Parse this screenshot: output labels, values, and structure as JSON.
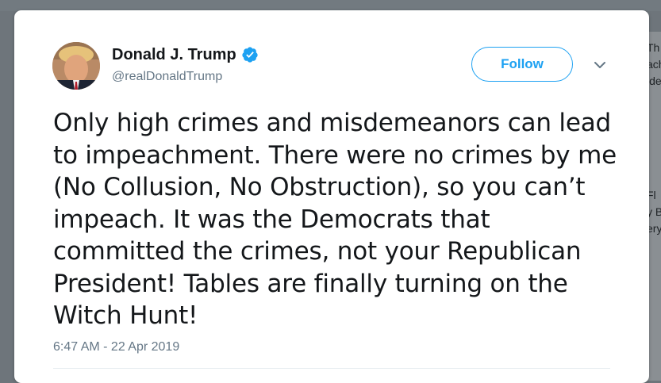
{
  "background": {
    "right_snippet_top": [
      "Th",
      "ach",
      "ide"
    ],
    "right_snippet_mid": [
      "Fl",
      "y B",
      "ery"
    ]
  },
  "tweet": {
    "author": {
      "display_name": "Donald J. Trump",
      "handle": "@realDonaldTrump",
      "verified": true
    },
    "follow_label": "Follow",
    "text_lines": [
      "Only high crimes and misdemeanors can lead",
      "to impeachment. There were no crimes by me",
      "(No Collusion, No Obstruction), so you can’t",
      "impeach. It was the Democrats that",
      "committed the crimes, not your Republican",
      "President! Tables are finally turning on the",
      "Witch Hunt!"
    ],
    "timestamp": "6:47 AM - 22 Apr 2019"
  },
  "colors": {
    "accent": "#1da1f2",
    "text_primary": "#14171a",
    "text_secondary": "#657786",
    "backdrop": "#6e757b"
  }
}
